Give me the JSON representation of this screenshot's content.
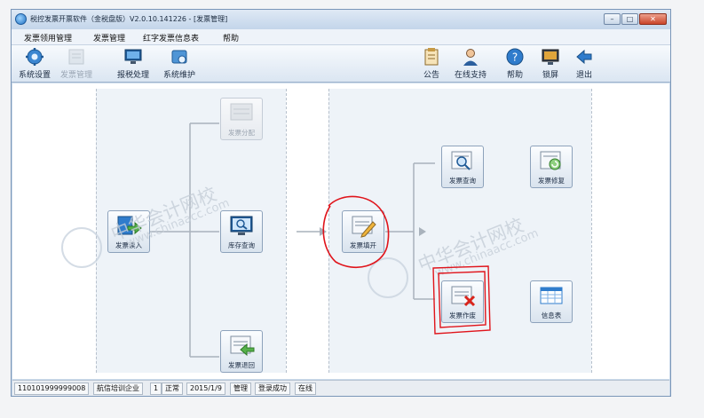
{
  "window": {
    "title": "税控发票开票软件（金税盘版）V2.0.10.141226 - [发票管理]",
    "min_glyph": "–",
    "max_glyph": "□",
    "close_glyph": "✕"
  },
  "menu": [
    "发票领用管理",
    "发票管理",
    "红字发票信息表",
    "帮助"
  ],
  "toolbar_left": [
    {
      "label": "系统设置",
      "icon": "gear-icon",
      "disabled": false
    },
    {
      "label": "发票管理",
      "icon": "invoice-icon",
      "disabled": true
    },
    {
      "label": "报税处理",
      "icon": "monitor-icon",
      "disabled": false
    },
    {
      "label": "系统维护",
      "icon": "maintenance-icon",
      "disabled": false
    }
  ],
  "toolbar_right": [
    {
      "label": "公告",
      "icon": "clipboard-icon"
    },
    {
      "label": "在线支持",
      "icon": "user-icon"
    },
    {
      "label": "帮助",
      "icon": "help-icon"
    },
    {
      "label": "锁屏",
      "icon": "lock-screen-icon"
    },
    {
      "label": "退出",
      "icon": "exit-icon"
    }
  ],
  "cards": {
    "fapiao_duru": "发票读入",
    "fapiao_fenpei": "发票分配",
    "kucun_chaxun": "库存查询",
    "fapiao_tuihui": "发票退回",
    "fapiao_tiankai": "发票填开",
    "fapiao_chaxun": "发票查询",
    "fapiao_xiufu": "发票修复",
    "fapiao_zuofei": "发票作废",
    "xinxibiao": "信息表"
  },
  "status": [
    "110101999999008",
    "航信培训企业",
    "1",
    "正常",
    "2015/1/9",
    "管理",
    "登录成功",
    "在线"
  ],
  "watermark": {
    "main": "中华会计网校",
    "url": "www.chinaacc.com"
  },
  "colors": {
    "accent": "#1e6fc0",
    "annotation": "#e0141b"
  }
}
